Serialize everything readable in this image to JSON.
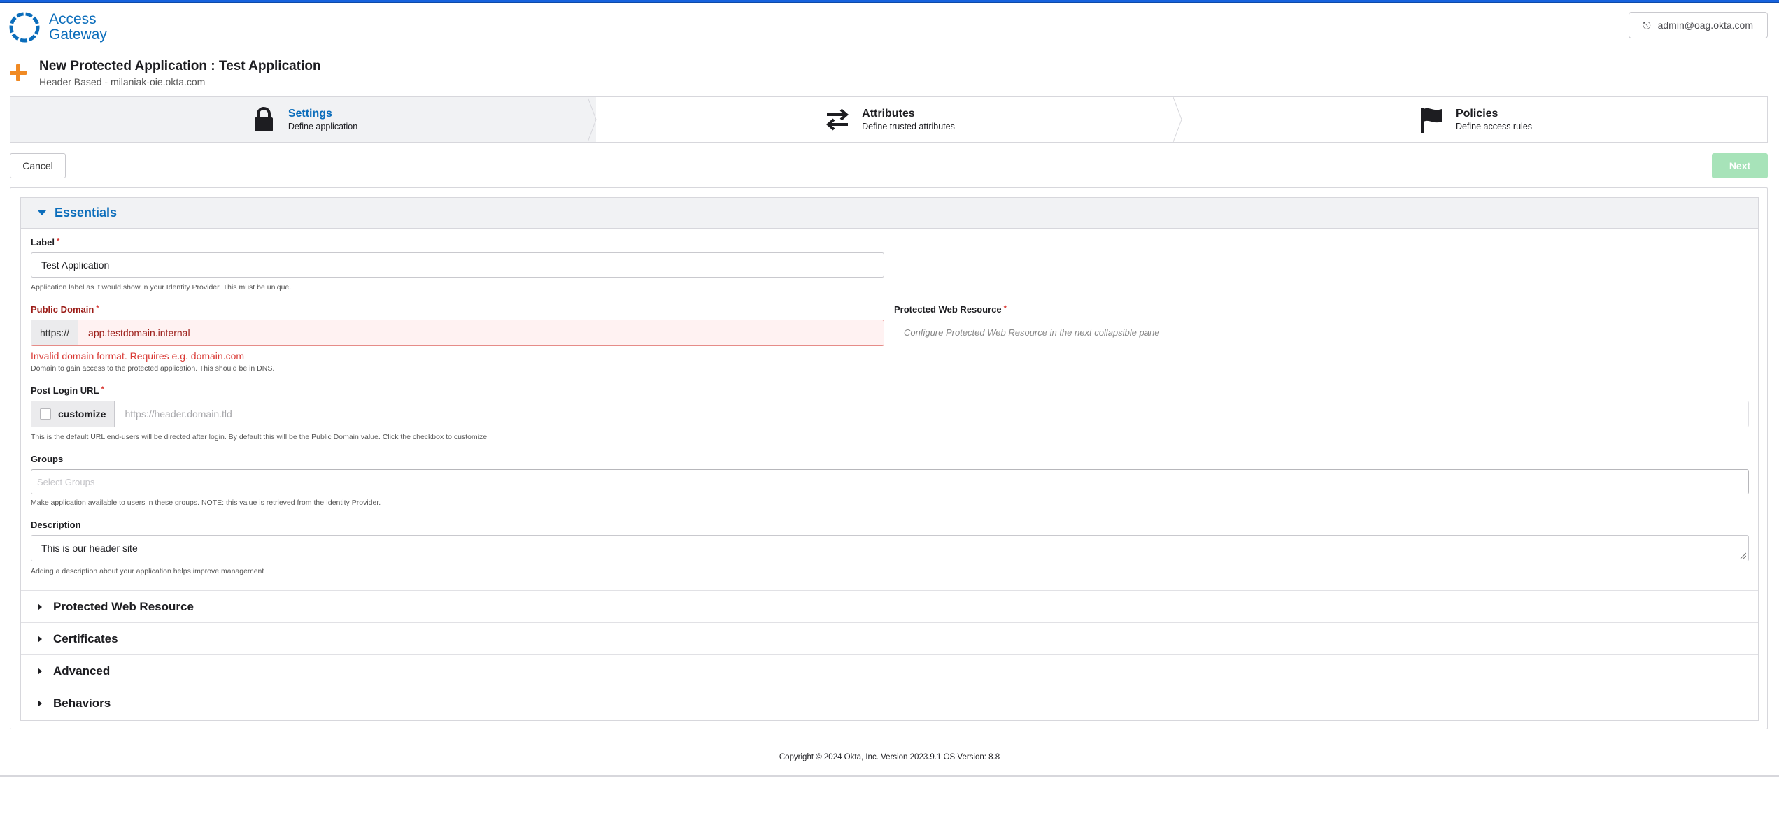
{
  "header": {
    "logo_line1": "Access",
    "logo_line2": "Gateway",
    "user_email": "admin@oag.okta.com"
  },
  "page": {
    "title_prefix": "New Protected Application :",
    "app_name": "Test Application",
    "subtitle": "Header Based - milaniak-oie.okta.com"
  },
  "steps": [
    {
      "title": "Settings",
      "desc": "Define application",
      "icon": "lock-icon",
      "active": true
    },
    {
      "title": "Attributes",
      "desc": "Define trusted attributes",
      "icon": "swap-arrows-icon",
      "active": false
    },
    {
      "title": "Policies",
      "desc": "Define access rules",
      "icon": "flag-icon",
      "active": false
    }
  ],
  "actions": {
    "cancel": "Cancel",
    "next": "Next"
  },
  "essentials": {
    "title": "Essentials",
    "label": {
      "label": "Label",
      "required": "*",
      "value": "Test Application",
      "help": "Application label as it would show in your Identity Provider. This must be unique."
    },
    "public_domain": {
      "label": "Public Domain",
      "required": "*",
      "prefix": "https://",
      "value": "app.testdomain.internal",
      "error": "Invalid domain format. Requires e.g. domain.com",
      "help": "Domain to gain access to the protected application. This should be in DNS."
    },
    "protected_web_resource": {
      "label": "Protected Web Resource",
      "required": "*",
      "hint": "Configure Protected Web Resource in the next collapsible pane"
    },
    "post_login_url": {
      "label": "Post Login URL",
      "required": "*",
      "checkbox_label": "customize",
      "placeholder": "https://header.domain.tld",
      "help": "This is the default URL end-users will be directed after login. By default this will be the Public Domain value. Click the checkbox to customize"
    },
    "groups": {
      "label": "Groups",
      "placeholder": "Select Groups",
      "help": "Make application available to users in these groups. NOTE: this value is retrieved from the Identity Provider."
    },
    "description": {
      "label": "Description",
      "value": "This is our header site",
      "help": "Adding a description about your application helps improve management"
    }
  },
  "sections": [
    "Protected Web Resource",
    "Certificates",
    "Advanced",
    "Behaviors"
  ],
  "footer": {
    "text": "Copyright © 2024 Okta, Inc. Version 2023.9.1 OS Version: 8.8"
  },
  "colors": {
    "brand": "#0b6dbb",
    "accent": "#f08a24",
    "error": "#d93934",
    "next_disabled": "#a7e3b9"
  }
}
